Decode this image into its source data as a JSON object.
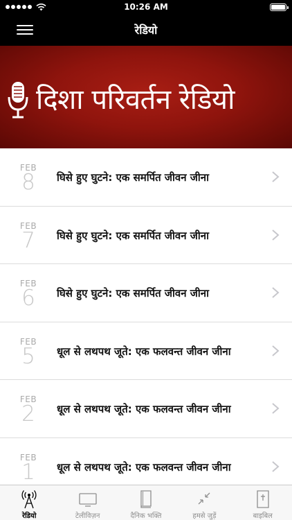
{
  "status_bar": {
    "time": "10:26 AM"
  },
  "nav": {
    "title": "रेडियो"
  },
  "banner": {
    "text": "दिशा  परिवर्तन रेडियो"
  },
  "episodes": [
    {
      "month": "FEB",
      "day": "8",
      "title": "घिसे हुए घुटने: एक समर्पित जीवन जीना"
    },
    {
      "month": "FEB",
      "day": "7",
      "title": "घिसे हुए घुटने: एक समर्पित जीवन जीना"
    },
    {
      "month": "FEB",
      "day": "6",
      "title": "घिसे हुए घुटने: एक समर्पित जीवन जीना"
    },
    {
      "month": "FEB",
      "day": "5",
      "title": "धूल से लथपथ जूते: एक फलवन्त जीवन जीना"
    },
    {
      "month": "FEB",
      "day": "2",
      "title": "धूल से लथपथ जूते: एक फलवन्त जीवन जीना"
    },
    {
      "month": "FEB",
      "day": "1",
      "title": "धूल से लथपथ जूते: एक फलवन्त जीवन जीना"
    }
  ],
  "tabs": [
    {
      "label": "रेडियो",
      "icon": "radio-tower-icon",
      "active": true
    },
    {
      "label": "टेलीविज़न",
      "icon": "tv-icon",
      "active": false
    },
    {
      "label": "दैनिक भक्ति",
      "icon": "book-icon",
      "active": false
    },
    {
      "label": "हमसे जुड़ें",
      "icon": "connect-arrows-icon",
      "active": false
    },
    {
      "label": "बाइबिल",
      "icon": "bible-icon",
      "active": false
    }
  ],
  "colors": {
    "banner_red": "#a81e14",
    "bar_black": "#000000",
    "tab_inactive": "#8e8e8e"
  }
}
